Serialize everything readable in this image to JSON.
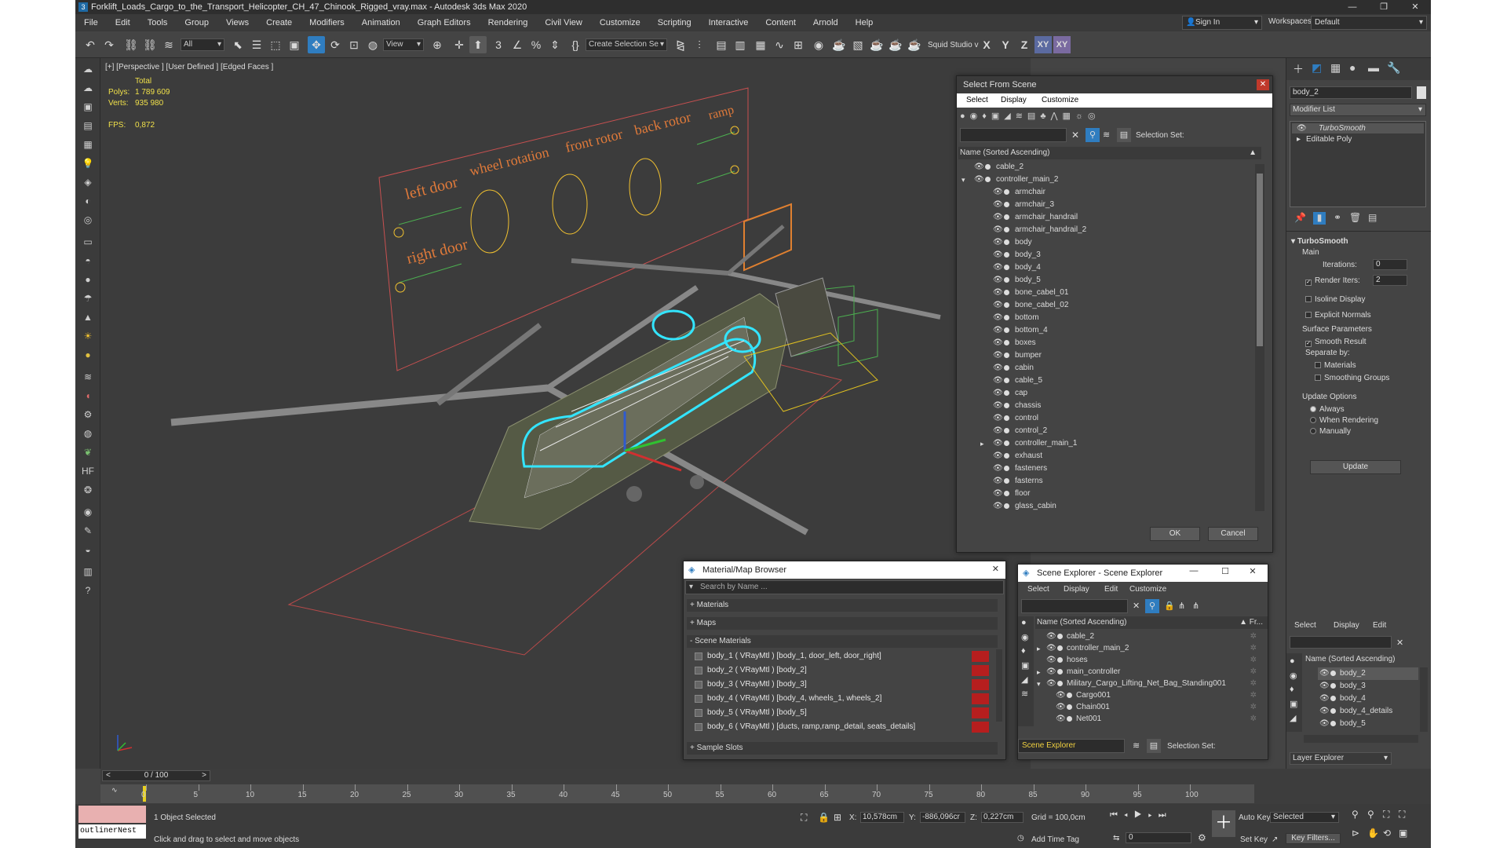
{
  "window": {
    "title": "Forklift_Loads_Cargo_to_the_Transport_Helicopter_CH_47_Chinook_Rigged_vray.max - Autodesk 3ds Max 2020"
  },
  "menu": [
    "File",
    "Edit",
    "Tools",
    "Group",
    "Views",
    "Create",
    "Modifiers",
    "Animation",
    "Graph Editors",
    "Rendering",
    "Civil View",
    "Customize",
    "Scripting",
    "Interactive",
    "Content",
    "Arnold",
    "Help"
  ],
  "signin": "Sign In",
  "workspace": {
    "label": "Workspaces:",
    "value": "Default"
  },
  "toolbar": {
    "filter": "All",
    "refcoord": "View",
    "selset": "Create Selection Se",
    "squid": "Squid Studio v",
    "axes": [
      "X",
      "Y",
      "Z",
      "XY",
      "XY"
    ]
  },
  "viewport": {
    "label": "[+] [Perspective ] [User Defined ] [Edged Faces ]",
    "stats_total": "Total",
    "polys_label": "Polys:",
    "polys": "1 789 609",
    "verts_label": "Verts:",
    "verts": "935 980",
    "fps_label": "FPS:",
    "fps": "0,872",
    "rig_labels": [
      "left door",
      "wheel rotation",
      "front rotor",
      "back rotor",
      "ramp",
      "right door"
    ]
  },
  "select_from_scene": {
    "title": "Select From Scene",
    "menu": [
      "Select",
      "Display",
      "Customize"
    ],
    "selection_set": "Selection Set:",
    "header": "Name (Sorted Ascending)",
    "rows": [
      {
        "name": "cable_2",
        "indent": 0
      },
      {
        "name": "controller_main_2",
        "indent": 0,
        "expand": "open"
      },
      {
        "name": "armchair",
        "indent": 1
      },
      {
        "name": "armchair_3",
        "indent": 1
      },
      {
        "name": "armchair_handrail",
        "indent": 1
      },
      {
        "name": "armchair_handrail_2",
        "indent": 1
      },
      {
        "name": "body",
        "indent": 1
      },
      {
        "name": "body_3",
        "indent": 1
      },
      {
        "name": "body_4",
        "indent": 1
      },
      {
        "name": "body_5",
        "indent": 1
      },
      {
        "name": "bone_cabel_01",
        "indent": 1
      },
      {
        "name": "bone_cabel_02",
        "indent": 1
      },
      {
        "name": "bottom",
        "indent": 1
      },
      {
        "name": "bottom_4",
        "indent": 1
      },
      {
        "name": "boxes",
        "indent": 1
      },
      {
        "name": "bumper",
        "indent": 1
      },
      {
        "name": "cabin",
        "indent": 1
      },
      {
        "name": "cable_5",
        "indent": 1
      },
      {
        "name": "cap",
        "indent": 1
      },
      {
        "name": "chassis",
        "indent": 1
      },
      {
        "name": "control",
        "indent": 1
      },
      {
        "name": "control_2",
        "indent": 1
      },
      {
        "name": "controller_main_1",
        "indent": 1,
        "expand": "closed"
      },
      {
        "name": "exhaust",
        "indent": 1
      },
      {
        "name": "fasteners",
        "indent": 1
      },
      {
        "name": "fasterns",
        "indent": 1
      },
      {
        "name": "floor",
        "indent": 1
      },
      {
        "name": "glass_cabin",
        "indent": 1
      }
    ],
    "ok": "OK",
    "cancel": "Cancel"
  },
  "material_browser": {
    "title": "Material/Map Browser",
    "search_placeholder": "Search by Name ...",
    "sections": [
      "+ Materials",
      "+ Maps",
      "- Scene Materials"
    ],
    "materials": [
      "body_1  ( VRayMtl ) [body_1, door_left, door_right]",
      "body_2  ( VRayMtl ) [body_2]",
      "body_3  ( VRayMtl ) [body_3]",
      "body_4  ( VRayMtl ) [body_4, wheels_1, wheels_2]",
      "body_5  ( VRayMtl ) [body_5]",
      "body_6  ( VRayMtl ) [ducts, ramp,ramp_detail, seats_details]"
    ],
    "sample_slots": "+ Sample Slots"
  },
  "scene_explorer": {
    "title": "Scene Explorer - Scene Explorer",
    "menu": [
      "Select",
      "Display",
      "Edit",
      "Customize"
    ],
    "header": "Name (Sorted Ascending)",
    "header_right": "▲ Fr...",
    "rows": [
      {
        "name": "cable_2",
        "indent": 0
      },
      {
        "name": "controller_main_2",
        "indent": 0,
        "expand": "closed"
      },
      {
        "name": "hoses",
        "indent": 0
      },
      {
        "name": "main_controller",
        "indent": 0,
        "expand": "closed"
      },
      {
        "name": "Military_Cargo_Lifting_Net_Bag_Standing001",
        "indent": 0,
        "expand": "open"
      },
      {
        "name": "Cargo001",
        "indent": 1
      },
      {
        "name": "Chain001",
        "indent": 1
      },
      {
        "name": "Net001",
        "indent": 1
      }
    ],
    "footer_name": "Scene Explorer",
    "selection_set": "Selection Set:"
  },
  "command_panel": {
    "object_name": "body_2",
    "modifier_list": "Modifier List",
    "stack": [
      "TurboSmooth",
      "Editable Poly"
    ],
    "rollout": "TurboSmooth",
    "main": "Main",
    "iterations_label": "Iterations:",
    "iterations": "0",
    "render_iters_label": "Render Iters:",
    "render_iters": "2",
    "isoline": "Isoline Display",
    "explicit": "Explicit Normals",
    "surface": "Surface Parameters",
    "smooth_result": "Smooth Result",
    "separate": "Separate by:",
    "materials": "Materials",
    "smoothing_groups": "Smoothing Groups",
    "update_options": "Update Options",
    "always": "Always",
    "when_rendering": "When Rendering",
    "manually": "Manually",
    "update": "Update"
  },
  "layer_explorer": {
    "menu": [
      "Select",
      "Display",
      "Edit"
    ],
    "header": "Name (Sorted Ascending)",
    "rows": [
      "body_2",
      "body_3",
      "body_4",
      "body_4_details",
      "body_5"
    ],
    "footer": "Layer Explorer"
  },
  "timeline": {
    "frame": "0 / 100",
    "ticks": [
      "0",
      "5",
      "10",
      "15",
      "20",
      "25",
      "30",
      "35",
      "40",
      "45",
      "50",
      "55",
      "60",
      "65",
      "70",
      "75",
      "80",
      "85",
      "90",
      "95",
      "100"
    ]
  },
  "status": {
    "listener": "outlinerNest",
    "selected": "1 Object Selected",
    "hint": "Click and drag to select and move objects",
    "x_label": "X:",
    "x": "10,578cm",
    "y_label": "Y:",
    "y": "-886,096cr",
    "z_label": "Z:",
    "z": "0,227cm",
    "grid": "Grid = 100,0cm",
    "add_time_tag": "Add Time Tag",
    "auto_key": "Auto Key",
    "key_mode": "Selected",
    "set_key": "Set Key",
    "key_filters": "Key Filters...",
    "frame_field": "0"
  },
  "colors": {
    "accent": "#2f7dc0",
    "wire_cyan": "#33e5ff",
    "rig_orange": "#e07a3a",
    "ui_bg": "#444444"
  }
}
